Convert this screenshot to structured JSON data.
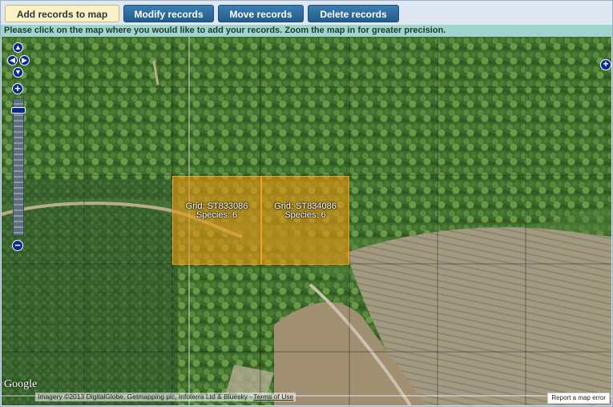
{
  "toolbar": {
    "tabs": [
      {
        "label": "Add records to map",
        "state": "active"
      },
      {
        "label": "Modify records",
        "state": "inactive"
      },
      {
        "label": "Move records",
        "state": "inactive"
      },
      {
        "label": "Delete records",
        "state": "inactive"
      }
    ]
  },
  "instruction": "Please click on the map where you would like to add your records. Zoom the map in for greater precision.",
  "map": {
    "grid_cells": [
      {
        "grid_label": "Grid: ST833086",
        "species_label": "Species: 6"
      },
      {
        "grid_label": "Grid: ST834086",
        "species_label": "Species: 6"
      }
    ],
    "controls": {
      "pan_up": "▲",
      "pan_left": "◀",
      "pan_right": "▶",
      "pan_down": "▼",
      "zoom_in": "+",
      "zoom_out": "−",
      "layer_switcher": "+"
    },
    "google_logo": "Google",
    "attribution": "Imagery ©2013 DigitalGlobe, Getmapping plc, Infoterra Ltd & Bluesky - ",
    "terms_link": "Terms of Use",
    "report_error": "Report a map error"
  },
  "colors": {
    "active_tab_bg": "#fbf1c7",
    "inactive_tab_bg": "#2a6a9b",
    "instruction_bar": "#9fd5cc",
    "grid_highlight": "#e89614",
    "control_blue": "#0a2a8a"
  }
}
